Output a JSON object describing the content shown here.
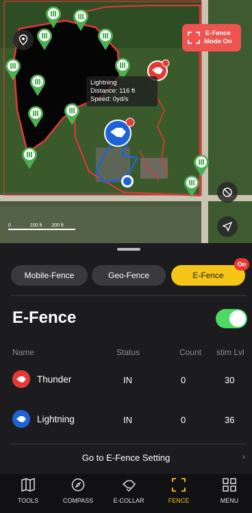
{
  "map": {
    "tooltip": {
      "name": "Lightning",
      "distance": "Distance: 116 ft",
      "speed": "Speed: 0yd/s"
    },
    "efence_chip": "E-Fence\nMode On",
    "scale": {
      "zero": "0",
      "mid": "100 ft",
      "end": "200 ft"
    },
    "fence_icon_count": 15,
    "colors": {
      "fence": "#e53935",
      "water": "#050505",
      "blue_track": "#1e63d6",
      "red_track": "#e53935",
      "marker": "#4caf50"
    }
  },
  "tabs": [
    {
      "label": "Mobile-Fence",
      "active": false
    },
    {
      "label": "Geo-Fence",
      "active": false
    },
    {
      "label": "E-Fence",
      "active": true,
      "badge": "On"
    }
  ],
  "section": {
    "title": "E-Fence",
    "toggle_on": true
  },
  "table": {
    "headers": {
      "name": "Name",
      "status": "Status",
      "count": "Count",
      "stim": "stim Lvl"
    },
    "rows": [
      {
        "name": "Thunder",
        "status": "IN",
        "count": "0",
        "stim": "30",
        "color": "#e53935"
      },
      {
        "name": "Lightning",
        "status": "IN",
        "count": "0",
        "stim": "36",
        "color": "#1e63d6"
      }
    ]
  },
  "link": {
    "label": "Go to E-Fence Setting",
    "chevron": "›"
  },
  "nav": [
    {
      "label": "TOOLS",
      "icon": "map-icon"
    },
    {
      "label": "COMPASS",
      "icon": "compass-icon"
    },
    {
      "label": "E-COLLAR",
      "icon": "collar-icon"
    },
    {
      "label": "FENCE",
      "icon": "fence-icon",
      "active": true
    },
    {
      "label": "MENU",
      "icon": "grid-icon"
    }
  ]
}
